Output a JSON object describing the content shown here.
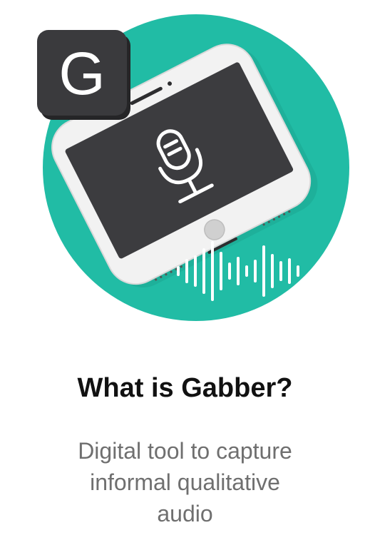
{
  "logo": {
    "letter": "G"
  },
  "colors": {
    "accent_circle": "#21BCA5",
    "logo_background": "#3A3A3D",
    "phone_body": "#F2F2F2",
    "phone_screen": "#3C3C3F",
    "sound_wave": "#FFFFFF",
    "title_text": "#111111",
    "subtitle_text": "#6F6F6F"
  },
  "icons": [
    "gabber-logo-icon",
    "smartphone-icon",
    "microphone-icon",
    "sound-wave-icon"
  ],
  "content": {
    "title": "What is Gabber?",
    "subtitle_lines": [
      "Digital tool to capture",
      "informal qualitative",
      "audio"
    ]
  }
}
